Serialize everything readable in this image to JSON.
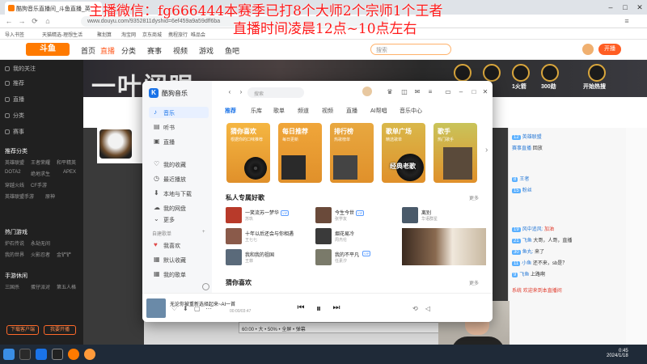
{
  "overlay": {
    "line1": "主播微信：fg666444本赛季已打8个大师2个宗师1个王者",
    "line2": "直播时间凌晨12点~10点左右"
  },
  "browser": {
    "tab_title": "酷狗音乐直播间_斗鱼直播_英",
    "url": "www.douyu.com/9352811dyshid=6ef459a9a59dff6ba",
    "bookmarks": [
      "导入书签",
      "天猫精选-理想生活",
      "聚划算",
      "淘宝网",
      "京东商城",
      "携程旅行",
      "唯品会"
    ]
  },
  "site": {
    "logo": "斗鱼",
    "nav": [
      "首页",
      "直播",
      "分类",
      "赛事",
      "视频",
      "游戏",
      "鱼吧"
    ],
    "search_placeholder": "搜索",
    "open_live": "开播"
  },
  "leftbar": {
    "items": [
      "我的关注",
      "推荐",
      "直播",
      "分类",
      "赛事",
      "热门分类"
    ],
    "section_recommend": "推荐分类",
    "section_hot": "热门游戏",
    "section_more": "手游休闲",
    "grid": [
      "英雄联盟",
      "王者荣耀",
      "和平精英",
      "DOTA2",
      "绝地求生",
      "APEX",
      "穿越火线",
      "CF手游",
      "英雄联盟手游",
      "原神",
      "炉石传说",
      "永劫无间",
      "我的世界",
      "火影忍者",
      "金铲铲",
      "三国杀",
      "蛋仔派对",
      "第五人格"
    ],
    "btn_download": "下载客户端",
    "btn_start": "我要开播"
  },
  "banner": {
    "title": "一叶阅眼",
    "badges": [
      "开启",
      "1火箭",
      "300勋",
      "开始热搜"
    ]
  },
  "chat": {
    "messages": [
      {
        "level": "12",
        "nick": "英雄联盟",
        "text": ""
      },
      {
        "level": "",
        "nick": "赛事直播",
        "text": "回放"
      },
      {
        "level": "8",
        "nick": "王者",
        "text": ""
      },
      {
        "level": "15",
        "nick": "粉丝",
        "text": ""
      },
      {
        "level": "19",
        "nick": "风中追风:",
        "text": "加油"
      },
      {
        "level": "21",
        "nick": "飞鱼",
        "text": "大哥，人哥，直播"
      },
      {
        "level": "30",
        "nick": "鱼丸:",
        "text": "来了"
      },
      {
        "level": "11",
        "nick": "小鱼",
        "text": "还不来，sb是？"
      },
      {
        "level": "9",
        "nick": "飞鱼",
        "text": "上路啊"
      },
      {
        "level": "",
        "nick": "系统",
        "text": "欢迎来到本直播间"
      }
    ]
  },
  "music": {
    "app_name": "酷狗音乐",
    "nav": [
      "音乐",
      "听书",
      "直播"
    ],
    "nav2": [
      "我的收藏",
      "最近播放",
      "本地与下载",
      "我的网盘"
    ],
    "more_label": "更多",
    "playlists_label": "自建歌单",
    "playlists": [
      "我喜欢",
      "默认收藏",
      "我的歌单"
    ],
    "search_placeholder": "搜索",
    "tabs": [
      "推荐",
      "乐库",
      "歌单",
      "频道",
      "视频",
      "直播",
      "AI帮唱",
      "音乐中心"
    ],
    "cards": [
      {
        "title": "猜你喜欢",
        "subtitle": "根据你的口味推荐",
        "color": "#f5b642"
      },
      {
        "title": "每日推荐",
        "subtitle": "每日更新",
        "color": "#f0a63a"
      },
      {
        "title": "排行榜",
        "subtitle": "热歌榜单",
        "color": "#e8a840"
      },
      {
        "title": "歌单广场",
        "subtitle": "精选歌单",
        "color": "#d9b84a"
      },
      {
        "title": "歌手",
        "subtitle": "热门歌手",
        "color": "#c9c45a"
      }
    ],
    "classic_cover_text": "经典老歌",
    "section_title": "私人专属好歌",
    "section_more": "更多",
    "songs": [
      {
        "title": "一笑流苏一梦华",
        "artist": "苏玖",
        "tag": "VIP",
        "color": "#b83a2a"
      },
      {
        "title": "今生今世",
        "artist": "张学友",
        "tag": "VIP",
        "color": "#6a4a3a"
      },
      {
        "title": "离别",
        "artist": "华语群星",
        "tag": "",
        "color": "#4a5a6a"
      },
      {
        "title": "十年以后还会与你相遇",
        "artist": "王七七",
        "tag": "",
        "color": "#8a5a4a"
      },
      {
        "title": "烟花易冷",
        "artist": "周杰伦",
        "tag": "",
        "color": "#3a3a3a"
      },
      {
        "title": "我和我的祖国",
        "artist": "王菲",
        "tag": "",
        "color": "#5a6a7a"
      },
      {
        "title": "我的不平凡",
        "artist": "任素汐",
        "tag": "",
        "color": "#7a7a6a"
      },
      {
        "title": "光是回忆别人",
        "artist": "周深",
        "tag": "VIP",
        "color": "#2a3a4a"
      }
    ],
    "section2_title": "猜你喜欢",
    "now_playing": "无论你被重新选择起来~AI一首",
    "now_time": "00:00/03:47"
  },
  "taskbar": {
    "time": "0:45",
    "date": "2024/1/18"
  },
  "stream": {
    "toolbar_text": "60:00 • 大 • 50% • 全屏 • 弹幕"
  }
}
